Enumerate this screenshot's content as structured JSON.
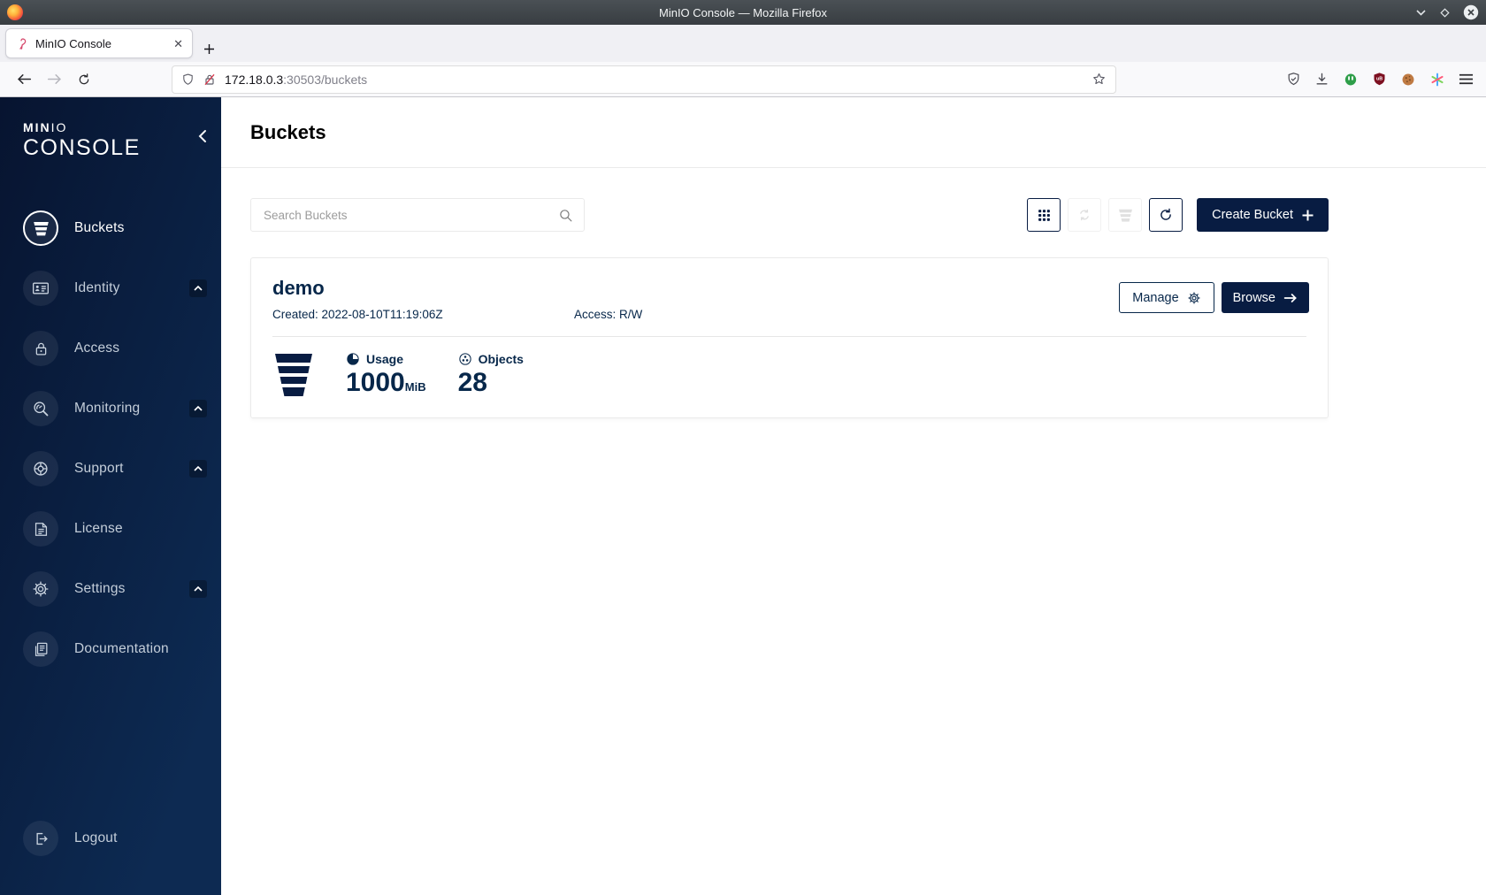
{
  "window": {
    "title": "MinIO Console — Mozilla Firefox"
  },
  "browser": {
    "tab_title": "MinIO Console",
    "url_host": "172.18.0.3",
    "url_path": ":30503/buckets"
  },
  "sidebar": {
    "logo_min": "MIN",
    "logo_io": "IO",
    "logo_console": "CONSOLE",
    "items": [
      {
        "label": "Buckets",
        "selected": true
      },
      {
        "label": "Identity",
        "expandable": true
      },
      {
        "label": "Access"
      },
      {
        "label": "Monitoring",
        "expandable": true
      },
      {
        "label": "Support",
        "expandable": true
      },
      {
        "label": "License"
      },
      {
        "label": "Settings",
        "expandable": true
      },
      {
        "label": "Documentation"
      }
    ],
    "logout_label": "Logout"
  },
  "main": {
    "page_title": "Buckets",
    "search_placeholder": "Search Buckets",
    "create_bucket_label": "Create Bucket",
    "bucket": {
      "name": "demo",
      "created": "Created: 2022-08-10T11:19:06Z",
      "access": "Access: R/W",
      "manage_label": "Manage",
      "browse_label": "Browse",
      "usage_label": "Usage",
      "usage_value": "1000",
      "usage_unit": "MiB",
      "objects_label": "Objects",
      "objects_value": "28"
    }
  },
  "colors": {
    "navy": "#081C42",
    "card_text": "#07274A",
    "sidebar_gradient_start": "#071430",
    "sidebar_gradient_end": "#0D2A52"
  }
}
